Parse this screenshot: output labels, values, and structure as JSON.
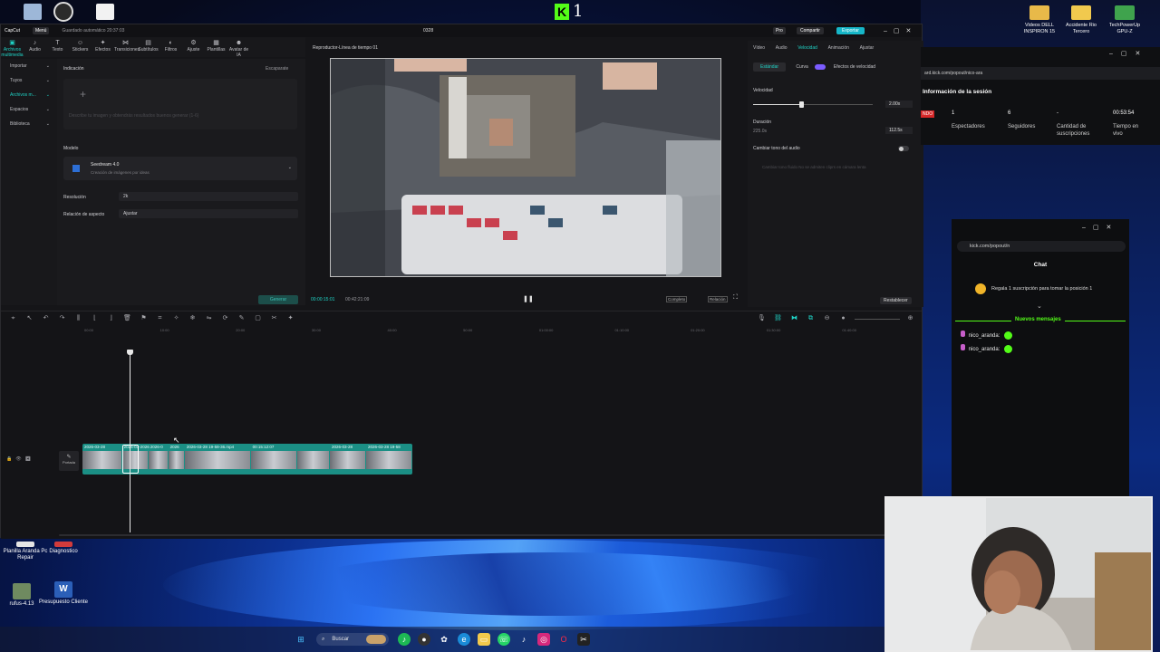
{
  "desktop": {
    "icons": [
      {
        "label": "Planilla Aranda Pc Repair"
      },
      {
        "label": "Diagnostico"
      },
      {
        "label": "rufus-4.13"
      },
      {
        "label": "Presupuesto Cliente"
      }
    ],
    "top_icons": [
      {
        "label": "Videos DELL INSPIRON 15"
      },
      {
        "label": "Accidente Rio Tercero"
      },
      {
        "label": "TechPowerUp GPU-Z"
      }
    ],
    "k_badge": "1"
  },
  "capcut": {
    "app_name": "CapCut",
    "menu": "Menú",
    "autosave": "Guardado automático 20:37:03",
    "project": "0328",
    "pro_label": "Pro",
    "share_label": "Compartir",
    "export_label": "Exportar",
    "toolbar": [
      {
        "label": "Archivos multimedia",
        "glyph": "▣"
      },
      {
        "label": "Audio",
        "glyph": "♪"
      },
      {
        "label": "Texto",
        "glyph": "T"
      },
      {
        "label": "Stickers",
        "glyph": "☺"
      },
      {
        "label": "Efectos",
        "glyph": "✦"
      },
      {
        "label": "Transiciones",
        "glyph": "⋈"
      },
      {
        "label": "Subtítulos",
        "glyph": "▤"
      },
      {
        "label": "Filtros",
        "glyph": "◐"
      },
      {
        "label": "Ajuste",
        "glyph": "⚙"
      },
      {
        "label": "Plantillas",
        "glyph": "▦"
      },
      {
        "label": "Avatar de IA",
        "glyph": "☻"
      }
    ],
    "leftnav": [
      {
        "label": "Importar"
      },
      {
        "label": "Tuyos"
      },
      {
        "label": "Archivos m..."
      },
      {
        "label": "Espacios"
      },
      {
        "label": "Biblioteca"
      }
    ],
    "panel": {
      "heading": "Indicación",
      "heading_right": "Escaparate",
      "prompt_placeholder": "Describe tu imagen y obtendrás resultados buenos generar (1-6)",
      "model_label": "Modelo",
      "model_name": "Seedream 4.0",
      "model_desc": "Creación de imágenes por ideas",
      "resolution_label": "Resolución",
      "resolution_value": "2k",
      "aspect_label": "Relación de aspecto",
      "aspect_value": "Ajustar",
      "generate_label": "Generar"
    },
    "player": {
      "title": "Reproductor-Línea de tiempo 01",
      "time_current": "00:00:15:01",
      "time_total": "00:42:21:09",
      "buttons": [
        "Completo",
        "Relación"
      ]
    },
    "right_panel": {
      "tabs": [
        "Vídeo",
        "Audio",
        "Velocidad",
        "Animación",
        "Ajustar"
      ],
      "active_tab": "Velocidad",
      "subtabs": [
        "Estándar",
        "Curva",
        "Efectos de velocidad"
      ],
      "speed_label": "Velocidad",
      "speed_value": "2.00x",
      "speed_level": 0.4,
      "duration_label": "Duración",
      "duration_from": "225.0s",
      "duration_value": "112.5s",
      "pitch_label": "Cambiar tono del audio",
      "hint": "Cambiar tono fluido  No se admiten cliprs en cámara lenta",
      "reset_label": "Restablecer"
    },
    "timeline": {
      "track_label": "Portada",
      "ruler": [
        "00:00",
        "10:00",
        "20:00",
        "30:00",
        "40:00",
        "50:00",
        "01:00:00",
        "01:10:00",
        "01:20:00",
        "01:30:00",
        "01:40:00"
      ],
      "clips": [
        {
          "label": "2026-03-28",
          "w": 0.12
        },
        {
          "label": "2026-03-2026",
          "w": 0.08
        },
        {
          "label": "2026-0",
          "w": 0.06
        },
        {
          "label": "2026",
          "w": 0.05
        },
        {
          "label": "2026-03-28 19-58-36.mp4",
          "w": 0.2
        },
        {
          "label": "00:15:12:07",
          "w": 0.14
        },
        {
          "label": "",
          "w": 0.1
        },
        {
          "label": "2026-03-28",
          "w": 0.11
        },
        {
          "label": "2026-03-28 19-58",
          "w": 0.14
        }
      ]
    }
  },
  "kick": {
    "url": "ard.kick.com/popout/nico-ara",
    "section": "Información de la sesión",
    "live_badge": "NDO",
    "stats": [
      {
        "value": "1",
        "label": "Espectadores"
      },
      {
        "value": "6",
        "label": "Seguidores"
      },
      {
        "value": "-",
        "label": "Cantidad de suscripciones"
      },
      {
        "value": "00:53:54",
        "label": "Tiempo en vivo"
      }
    ]
  },
  "chat": {
    "url": "kick.com/popout/n",
    "title": "Chat",
    "promo": "Regala 1 suscripción para tomar la posición 1",
    "new_messages": "Nuevos mensajes",
    "messages": [
      {
        "user": "nico_aranda:"
      },
      {
        "user": "nico_aranda:"
      }
    ]
  },
  "taskbar": {
    "search": "Buscar"
  },
  "colors": {
    "accent": "#1fd3c6",
    "kick_green": "#53fc18",
    "clip_teal": "#1b8f85"
  }
}
